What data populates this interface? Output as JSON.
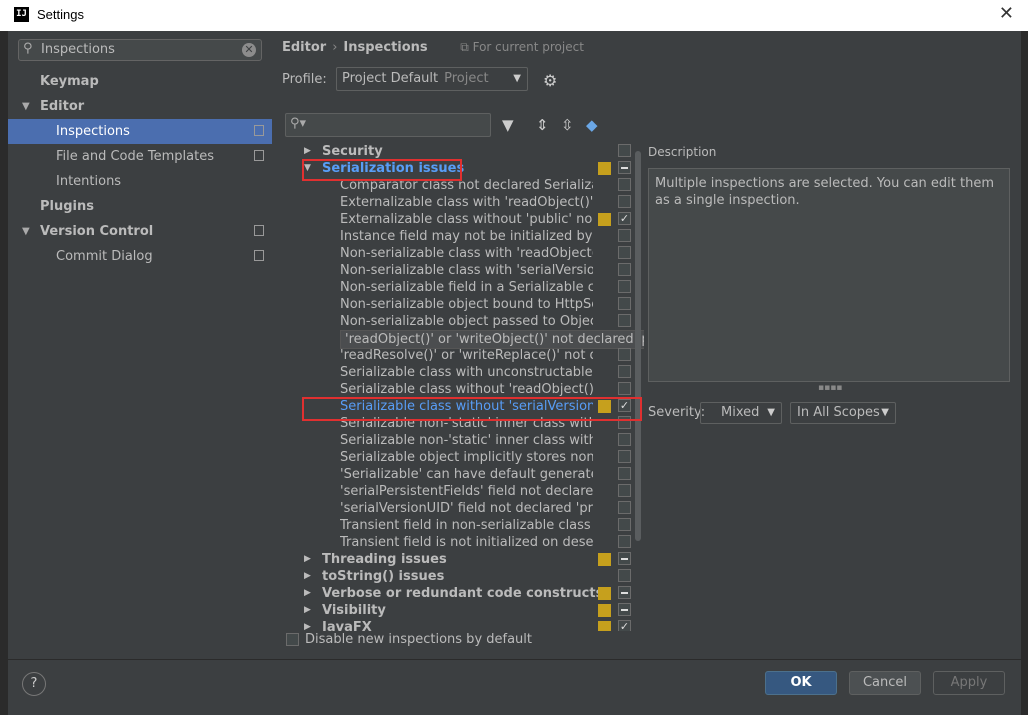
{
  "window": {
    "title": "Settings",
    "icon_text": "IJ",
    "close": "✕"
  },
  "sidebar": {
    "search_value": "Inspections",
    "items": [
      {
        "label": "Keymap"
      },
      {
        "label": "Editor"
      },
      {
        "label": "Inspections"
      },
      {
        "label": "File and Code Templates"
      },
      {
        "label": "Intentions"
      },
      {
        "label": "Plugins"
      },
      {
        "label": "Version Control"
      },
      {
        "label": "Commit Dialog"
      }
    ]
  },
  "main": {
    "breadcrumb": {
      "parent": "Editor",
      "sep": "›",
      "current": "Inspections",
      "scope": "For current project"
    },
    "profile": {
      "label": "Profile:",
      "value": "Project Default",
      "sub": "Project"
    },
    "inspections": {
      "groups_top": [
        {
          "label": "Security"
        },
        {
          "label": "Serialization issues"
        }
      ],
      "items": [
        {
          "label": "Comparator class not declared Serializable"
        },
        {
          "label": "Externalizable class with 'readObject()' or 'writeObject()'"
        },
        {
          "label": "Externalizable class without 'public' no-arg constructor"
        },
        {
          "label": "Instance field may not be initialized by 'readObject()'"
        },
        {
          "label": "Non-serializable class with 'readObject()' or 'writeObject()'"
        },
        {
          "label": "Non-serializable class with 'serialVersionUID'"
        },
        {
          "label": "Non-serializable field in a Serializable class"
        },
        {
          "label": "Non-serializable object bound to HttpSession"
        },
        {
          "label": "Non-serializable object passed to ObjectOutputStream"
        },
        {
          "label": "'readObject()' or 'writeObject()' not declared 'private'"
        },
        {
          "label": "'readResolve()' or 'writeReplace()' not declared 'protected'"
        },
        {
          "label": "Serializable class with unconstructable ancestor"
        },
        {
          "label": "Serializable class without 'readObject()' and 'writeObject()'"
        },
        {
          "label": "Serializable class without 'serialVersionUID'"
        },
        {
          "label": "Serializable non-'static' inner class with non-Serializable outer class"
        },
        {
          "label": "Serializable non-'static' inner class without 'serialVersionUID'"
        },
        {
          "label": "Serializable object implicitly stores non-Serializable object"
        },
        {
          "label": "'Serializable' can have default generated 'serialVersionUID'"
        },
        {
          "label": "'serialPersistentFields' field not declared 'private static final'"
        },
        {
          "label": "'serialVersionUID' field not declared 'private static final long'"
        },
        {
          "label": "Transient field in non-serializable class"
        },
        {
          "label": "Transient field is not initialized on deserialization"
        }
      ],
      "groups_bottom": [
        {
          "label": "Threading issues"
        },
        {
          "label": "toString() issues"
        },
        {
          "label": "Verbose or redundant code constructs"
        },
        {
          "label": "Visibility"
        },
        {
          "label": "JavaFX"
        }
      ],
      "tooltip": "'readObject()' or 'writeObject()' not declared 'private'"
    },
    "disable_new_label": "Disable new inspections by default",
    "description": {
      "label": "Description",
      "text": "Multiple inspections are selected. You can edit them as a single inspection."
    },
    "severity": {
      "label": "Severity:",
      "value": "Mixed",
      "scope": "In All Scopes"
    }
  },
  "footer": {
    "help": "?",
    "ok": "OK",
    "cancel": "Cancel",
    "apply": "Apply"
  },
  "colors": {
    "selection": "#4b6eaf",
    "link": "#589df6",
    "warning": "#c6a01d",
    "annotation": "#e03030"
  }
}
